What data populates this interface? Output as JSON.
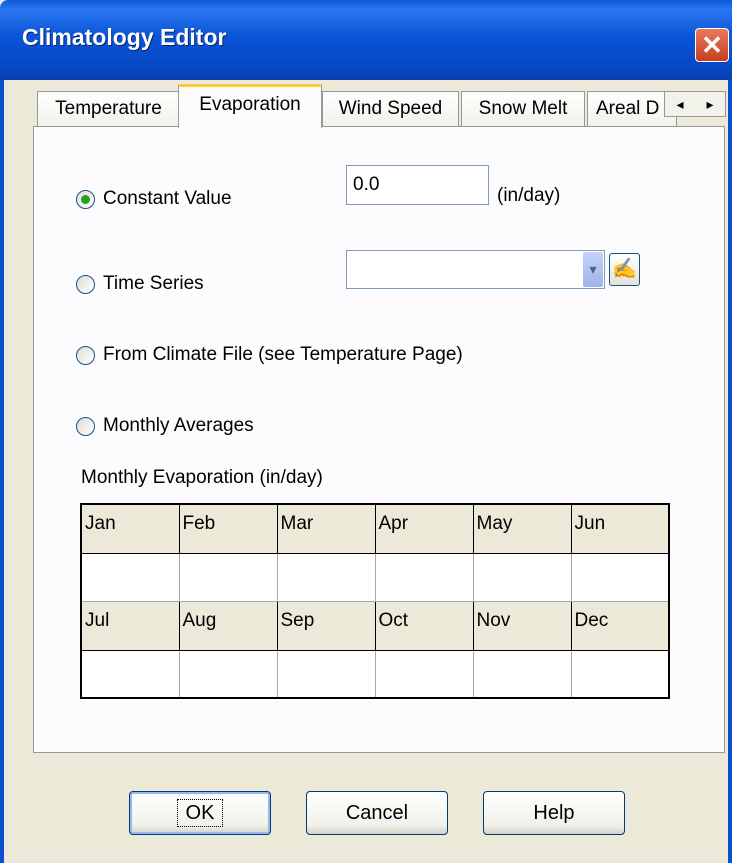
{
  "window": {
    "title": "Climatology Editor",
    "close_glyph": "✕"
  },
  "tabs": [
    {
      "label": "Temperature"
    },
    {
      "label": "Evaporation",
      "active": true
    },
    {
      "label": "Wind Speed"
    },
    {
      "label": "Snow Melt"
    },
    {
      "label": "Areal D"
    }
  ],
  "tab_scroll": {
    "left_glyph": "◂",
    "right_glyph": "▸"
  },
  "options": {
    "constant": {
      "label": "Constant Value",
      "checked": true
    },
    "timeseries": {
      "label": "Time Series",
      "checked": false
    },
    "climatefile": {
      "label": "From Climate File (see Temperature Page)",
      "checked": false
    },
    "monthly": {
      "label": "Monthly Averages",
      "checked": false
    }
  },
  "constant_value": "0.0",
  "constant_unit": "(in/day)",
  "timeseries_value": "",
  "combo_arrow": "▾",
  "edit_icon_glyph": "✍",
  "table": {
    "label": "Monthly Evaporation (in/day)",
    "row1_headers": [
      "Jan",
      "Feb",
      "Mar",
      "Apr",
      "May",
      "Jun"
    ],
    "row2_headers": [
      "Jul",
      "Aug",
      "Sep",
      "Oct",
      "Nov",
      "Dec"
    ]
  },
  "buttons": {
    "ok": "OK",
    "cancel": "Cancel",
    "help": "Help"
  }
}
